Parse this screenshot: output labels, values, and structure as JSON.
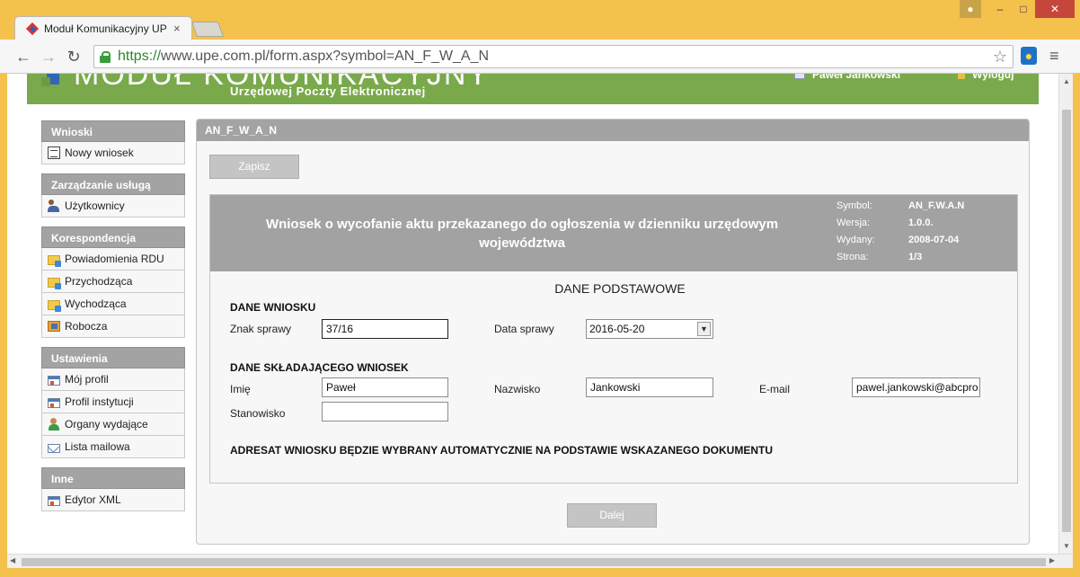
{
  "browser": {
    "tab_title": "Moduł Komunikacyjny UP",
    "url_scheme": "https://",
    "url_rest": "www.upe.com.pl/form.aspx?symbol=AN_F_W_A_N"
  },
  "header": {
    "title": "MODUŁ KOMUNIKACYJNY",
    "subtitle": "Urzędowej Poczty Elektronicznej",
    "user_name": "Paweł Jankowski",
    "logout": "Wyloguj"
  },
  "sidebar": {
    "groups": [
      {
        "title": "Wnioski",
        "items": [
          {
            "label": "Nowy wniosek",
            "icon": "document-icon"
          }
        ]
      },
      {
        "title": "Zarządzanie usługą",
        "items": [
          {
            "label": "Użytkownicy",
            "icon": "users-icon"
          }
        ]
      },
      {
        "title": "Korespondencja",
        "items": [
          {
            "label": "Powiadomienia RDU",
            "icon": "folder-icon"
          },
          {
            "label": "Przychodząca",
            "icon": "folder-icon"
          },
          {
            "label": "Wychodząca",
            "icon": "folder-icon"
          },
          {
            "label": "Robocza",
            "icon": "draft-icon"
          }
        ]
      },
      {
        "title": "Ustawienia",
        "items": [
          {
            "label": "Mój profil",
            "icon": "id-card-icon"
          },
          {
            "label": "Profil instytucji",
            "icon": "id-card-icon"
          },
          {
            "label": "Organy wydające",
            "icon": "person-icon"
          },
          {
            "label": "Lista mailowa",
            "icon": "mail-icon"
          }
        ]
      },
      {
        "title": "Inne",
        "items": [
          {
            "label": "Edytor XML",
            "icon": "id-card-icon"
          }
        ]
      }
    ]
  },
  "panel": {
    "title": "AN_F_W_A_N",
    "save_label": "Zapisz",
    "next_label": "Dalej",
    "form_title": "Wniosek o wycofanie aktu przekazanego do ogłoszenia w dzienniku urzędowym województwa",
    "meta": [
      {
        "key": "Symbol:",
        "value": "AN_F.W.A.N"
      },
      {
        "key": "Wersja:",
        "value": "1.0.0."
      },
      {
        "key": "Wydany:",
        "value": "2008-07-04"
      },
      {
        "key": "Strona:",
        "value": "1/3"
      }
    ],
    "section_title": "DANE PODSTAWOWE",
    "application": {
      "heading": "DANE WNIOSKU",
      "case_label": "Znak sprawy",
      "case_value": "37/16",
      "date_label": "Data sprawy",
      "date_value": "2016-05-20"
    },
    "applicant": {
      "heading": "DANE SKŁADAJĄCEGO WNIOSEK",
      "first_name_label": "Imię",
      "first_name_value": "Paweł",
      "last_name_label": "Nazwisko",
      "last_name_value": "Jankowski",
      "email_label": "E-mail",
      "email_value": "pawel.jankowski@abcpro.",
      "position_label": "Stanowisko",
      "position_value": ""
    },
    "note": "ADRESAT WNIOSKU BĘDZIE WYBRANY AUTOMATYCZNIE NA PODSTAWIE WSKAZANEGO DOKUMENTU"
  }
}
